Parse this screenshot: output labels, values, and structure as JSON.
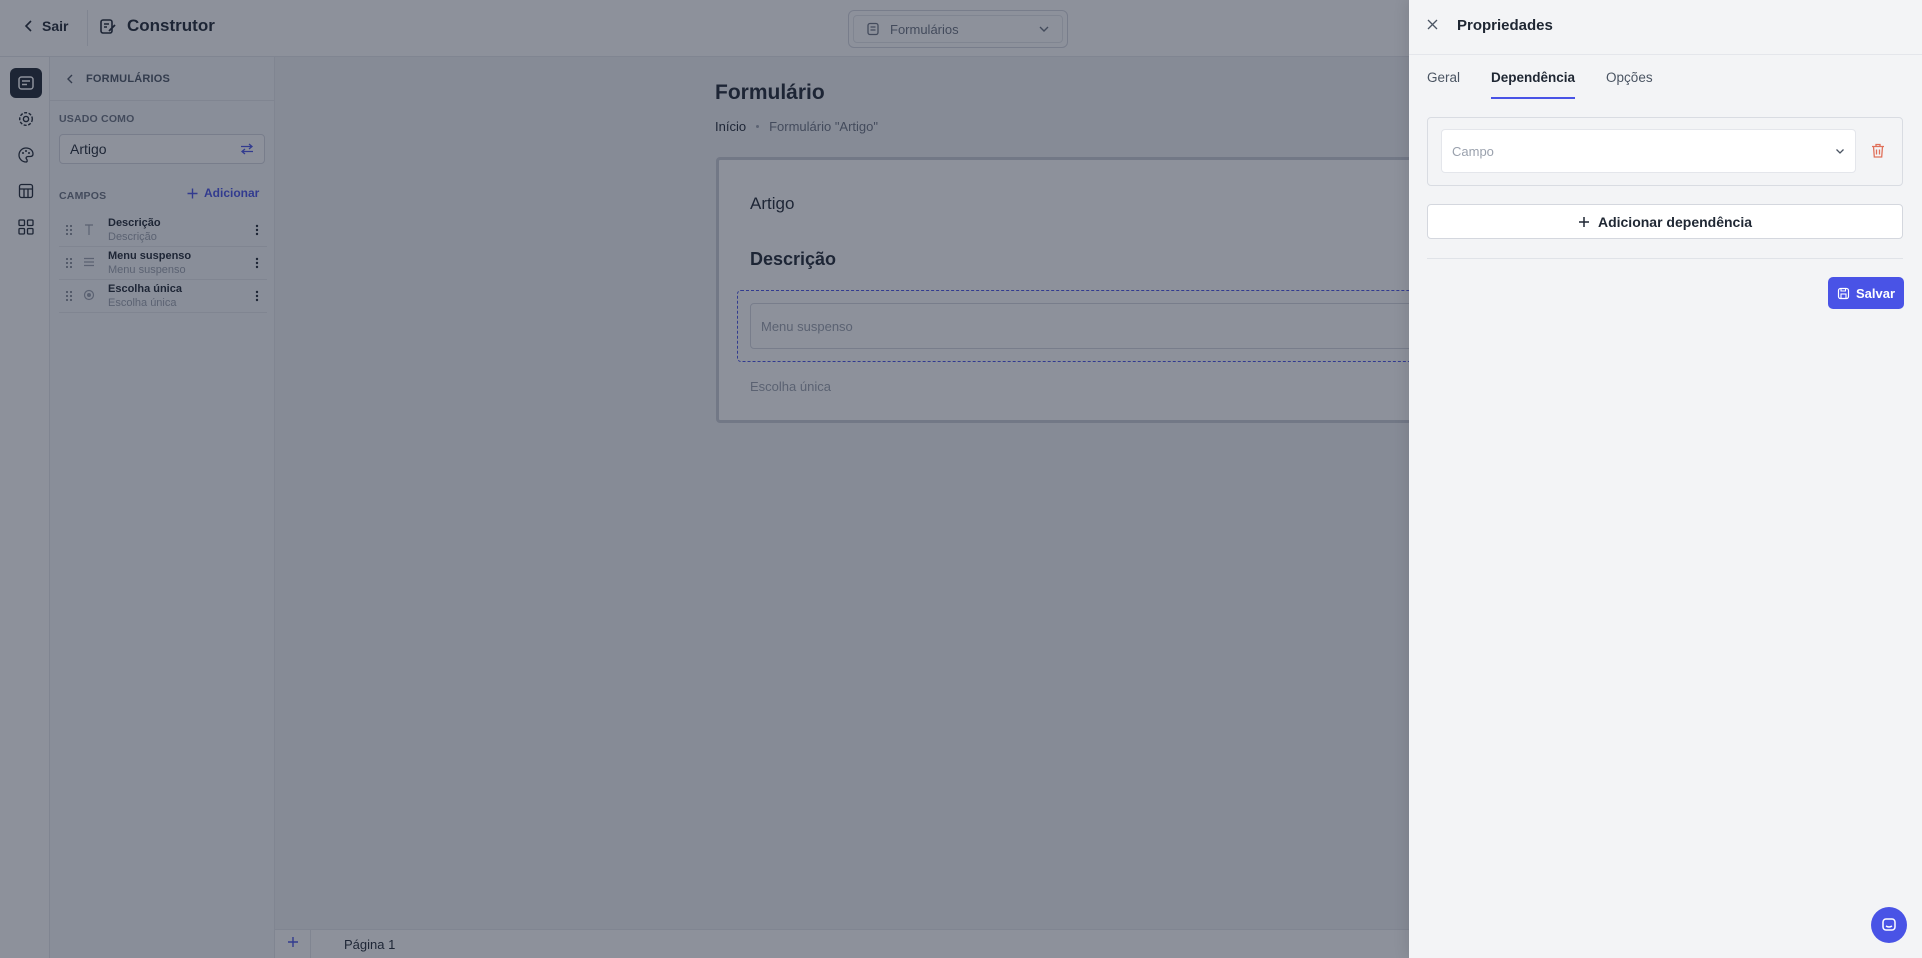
{
  "topbar": {
    "back_label": "Sair",
    "title": "Construtor",
    "module_select_value": "Formulários"
  },
  "left_panel": {
    "header": "FORMULÁRIOS",
    "used_as_label": "USADO COMO",
    "used_as_value": "Artigo",
    "fields_label": "CAMPOS",
    "add_label": "Adicionar",
    "fields": [
      {
        "name": "Descrição",
        "sub": "Descrição",
        "type_icon": "text-icon"
      },
      {
        "name": "Menu suspenso",
        "sub": "Menu suspenso",
        "type_icon": "list-icon"
      },
      {
        "name": "Escolha única",
        "sub": "Escolha única",
        "type_icon": "radio-icon"
      }
    ]
  },
  "canvas": {
    "page_title": "Formulário",
    "breadcrumb": [
      "Início",
      "Formulário \"Artigo\""
    ],
    "form": {
      "title": "Artigo",
      "description_heading": "Descrição",
      "dropdown_placeholder": "Menu suspenso",
      "single_choice_label": "Escolha única"
    },
    "page_tab": "Página 1"
  },
  "drawer": {
    "title": "Propriedades",
    "tabs": [
      {
        "label": "Geral",
        "active": false
      },
      {
        "label": "Dependência",
        "active": true
      },
      {
        "label": "Opções",
        "active": false
      }
    ],
    "field_placeholder": "Campo",
    "add_dependency_label": "Adicionar dependência",
    "save_label": "Salvar"
  },
  "colors": {
    "accent": "#4953e6",
    "danger": "#e0705a",
    "overlay": "rgba(28,36,56,0.50)"
  }
}
